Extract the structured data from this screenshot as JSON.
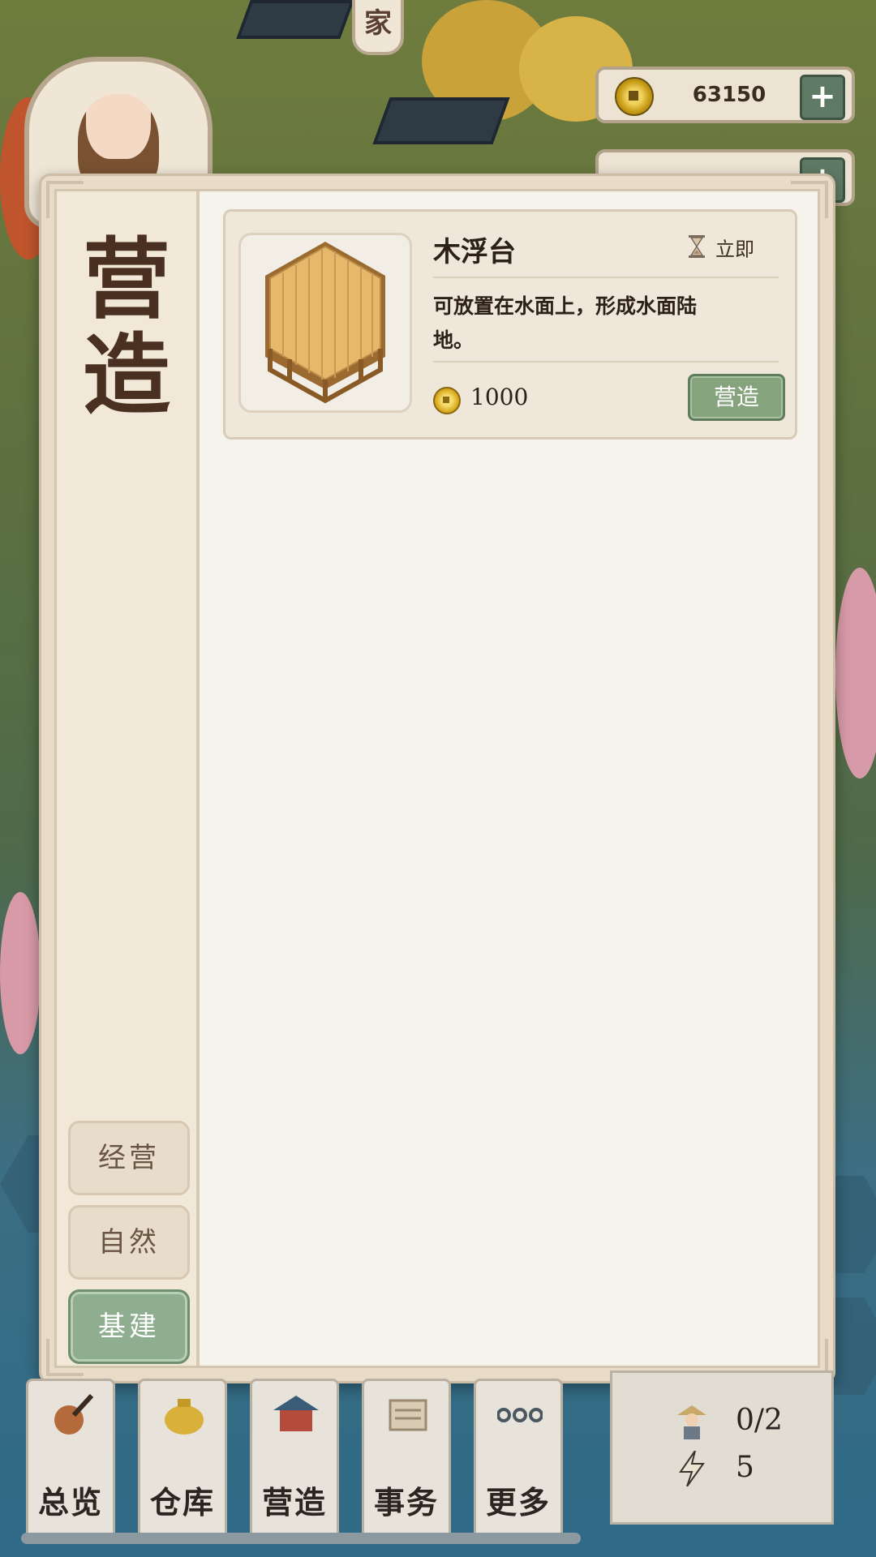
{
  "hud": {
    "family_tag": "家",
    "coins": "63150",
    "plus": "+"
  },
  "panel": {
    "title_line1": "营",
    "title_line2": "造",
    "categories": [
      {
        "label": "经营",
        "active": false
      },
      {
        "label": "自然",
        "active": false
      },
      {
        "label": "基建",
        "active": true
      }
    ]
  },
  "items": [
    {
      "name": "木浮台",
      "time": "立即",
      "description": "可放置在水面上，形成水面陆地。",
      "price": "1000",
      "action": "营造"
    }
  ],
  "bottom_nav": [
    {
      "label": "总览",
      "icon": "brush-icon"
    },
    {
      "label": "仓库",
      "icon": "money-bag-icon"
    },
    {
      "label": "营造",
      "icon": "pavilion-icon"
    },
    {
      "label": "事务",
      "icon": "documents-icon"
    },
    {
      "label": "更多",
      "icon": "more-icon"
    }
  ],
  "status": {
    "workers": "0/2",
    "energy": "5"
  },
  "colors": {
    "accent_green": "#85a37d",
    "panel_bg": "#f5f3ec",
    "title_brown": "#4a3020"
  }
}
